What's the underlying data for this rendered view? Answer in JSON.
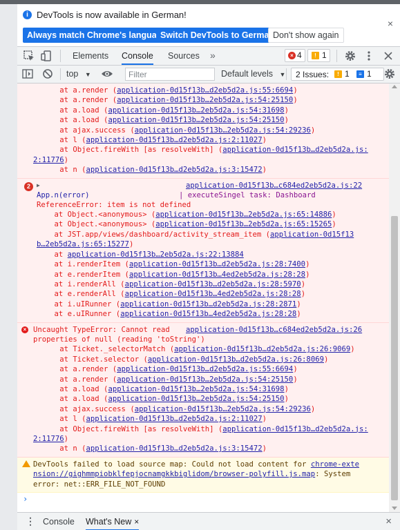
{
  "infobar": {
    "message": "DevTools is now available in German!",
    "btn_match": "Always match Chrome's language",
    "btn_switch": "Switch DevTools to German",
    "btn_dismiss": "Don't show again",
    "close": "×"
  },
  "toolbar": {
    "tabs": [
      "Elements",
      "Console",
      "Sources"
    ],
    "active_tab": "Console",
    "more": "»",
    "error_count": "4",
    "warning_count": "1"
  },
  "console_toolbar": {
    "context": "top",
    "filter_placeholder": "Filter",
    "levels": "Default levels",
    "issues_label": "2 Issues:",
    "issues_warnings": "1",
    "issues_info": "1"
  },
  "console": {
    "msg1_lines": [
      "      at a.render (|application-0d15f13b…d2eb5d2a.js:55:6694|)",
      "      at a.render (|application-0d15f13b…2eb5d2a.js:54:25150|)",
      "      at a.load (|application-0d15f13b…2eb5d2a.js:54:31698|)",
      "      at a.load (|application-0d15f13b…2eb5d2a.js:54:25150|)",
      "      at ajax.success (|application-0d15f13b…2eb5d2a.js:54:29236|)",
      "      at l (|application-0d15f13b…d2eb5d2a.js:2:11027|)",
      "      at Object.fireWith [as resolveWith] (|application-0d15f13b…d2eb5d2a.js:|",
      "|2:11776|)",
      "      at n (|application-0d15f13b…d2eb5d2a.js:3:15472|)"
    ],
    "msg2": {
      "badge": "2",
      "source": "application-0d15f13b…c684ed2eb5d2a.js:22",
      "label": "App.n(error)",
      "task": "| executeSingel task: Dashboard",
      "lines": [
        "ReferenceError: item is not defined",
        "    at Object.<anonymous> (|application-0d15f13b…2eb5d2a.js:65:14886|)",
        "    at Object.<anonymous> (|application-0d15f13b…2eb5d2a.js:65:15265|)",
        "    at JST.app/views/dashboard/activity_stream_item (|application-0d15f13|",
        "|b…2eb5d2a.js:65:15277|)",
        "    at |application-0d15f13b…2eb5d2a.js:22:13884|",
        "    at i.renderItem (|application-0d15f13b…d2eb5d2a.js:28:7400|)",
        "    at e.renderItem (|application-0d15f13b…4ed2eb5d2a.js:28:28|)",
        "    at i.renderAll (|application-0d15f13b…d2eb5d2a.js:28:5970|)",
        "    at e.renderAll (|application-0d15f13b…4ed2eb5d2a.js:28:28|)",
        "    at i.uIRunner (|application-0d15f13b…d2eb5d2a.js:28:2871|)",
        "    at e.uIRunner (|application-0d15f13b…4ed2eb5d2a.js:28:28|)"
      ]
    },
    "msg3": {
      "source": "application-0d15f13b…c684ed2eb5d2a.js:26",
      "lines": [
        "Uncaught TypeError: Cannot read",
        "properties of null (reading 'toString')",
        "      at Ticket._selectorMatch (|application-0d15f13b…d2eb5d2a.js:26:9069|)",
        "      at Ticket.selector (|application-0d15f13b…d2eb5d2a.js:26:8069|)",
        "      at a.render (|application-0d15f13b…d2eb5d2a.js:55:6694|)",
        "      at a.render (|application-0d15f13b…2eb5d2a.js:54:25150|)",
        "      at a.load (|application-0d15f13b…2eb5d2a.js:54:31698|)",
        "      at a.load (|application-0d15f13b…2eb5d2a.js:54:25150|)",
        "      at ajax.success (|application-0d15f13b…2eb5d2a.js:54:29236|)",
        "      at l (|application-0d15f13b…d2eb5d2a.js:2:11027|)",
        "      at Object.fireWith [as resolveWith] (|application-0d15f13b…d2eb5d2a.js:|",
        "|2:11776|)",
        "      at n (|application-0d15f13b…d2eb5d2a.js:3:15472|)"
      ]
    },
    "msg4": {
      "lines": [
        "DevTools failed to load source map: Could not load content for |chrome-exte|",
        "|nsion://gighmmpiobklfepjocnamgkkbiglidom/browser-polyfill.js.map|: System",
        "error: net::ERR_FILE_NOT_FOUND"
      ]
    },
    "prompt": "›"
  },
  "drawer": {
    "menu": "⋮",
    "tabs": [
      "Console",
      "What's New"
    ],
    "active_tab": "What's New",
    "tab_close": "×",
    "close": "×"
  }
}
